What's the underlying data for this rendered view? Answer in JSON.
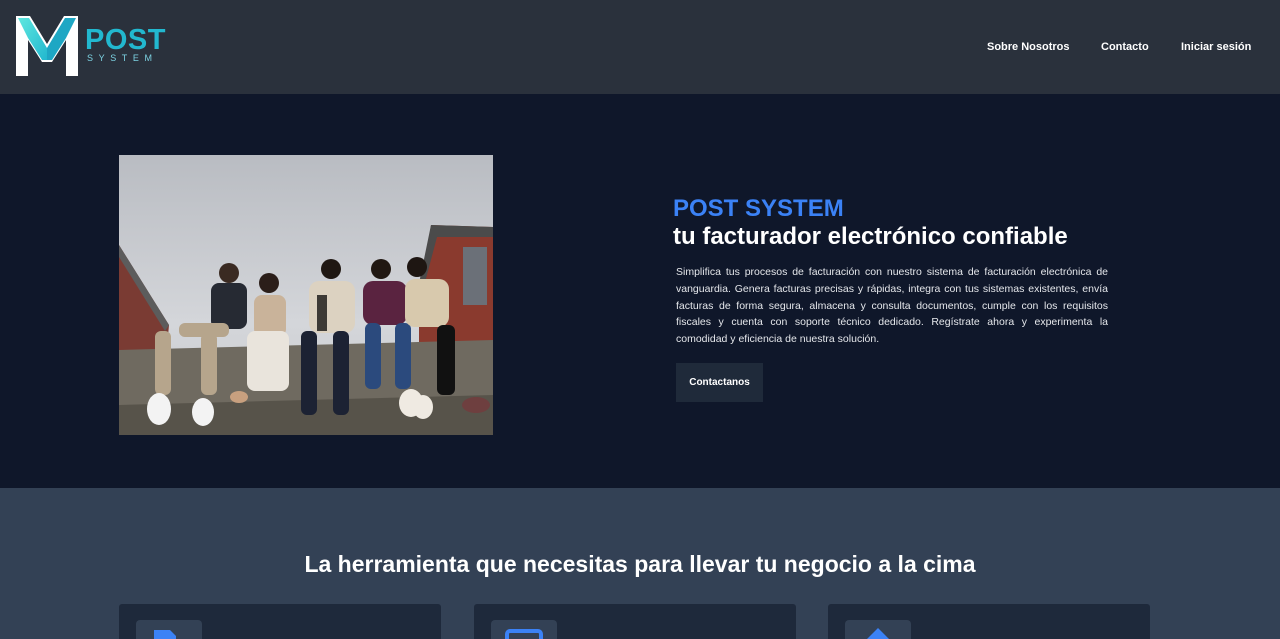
{
  "brand": {
    "logo_letter": "M",
    "logo_post": "POST",
    "logo_system": "SYSTEM"
  },
  "nav": {
    "items": [
      {
        "label": "Sobre Nosotros"
      },
      {
        "label": "Contacto"
      },
      {
        "label": "Iniciar sesión"
      }
    ]
  },
  "hero": {
    "title": "POST SYSTEM",
    "subtitle": "tu facturador electrónico confiable",
    "description": "Simplifica tus procesos de facturación con nuestro sistema de facturación electrónica de vanguardia. Genera facturas precisas y rápidas, integra con tus sistemas existentes, envía facturas de forma segura, almacena y consulta documentos, cumple con los requisitos fiscales y cuenta con soporte técnico dedicado. Regístrate ahora y experimenta la comodidad y eficiencia de nuestra solución.",
    "cta_label": "Contactanos"
  },
  "features": {
    "heading": "La herramienta que necesitas para llevar tu negocio a la cima",
    "cards": [
      {
        "icon": "document-icon"
      },
      {
        "icon": "monitor-icon"
      },
      {
        "icon": "home-icon"
      }
    ]
  },
  "colors": {
    "header_bg": "#2a313c",
    "hero_bg": "#0f172a",
    "section_bg": "#334155",
    "card_bg": "#1e293b",
    "accent_blue": "#3b82f6",
    "logo_cyan": "#22b8cf"
  }
}
